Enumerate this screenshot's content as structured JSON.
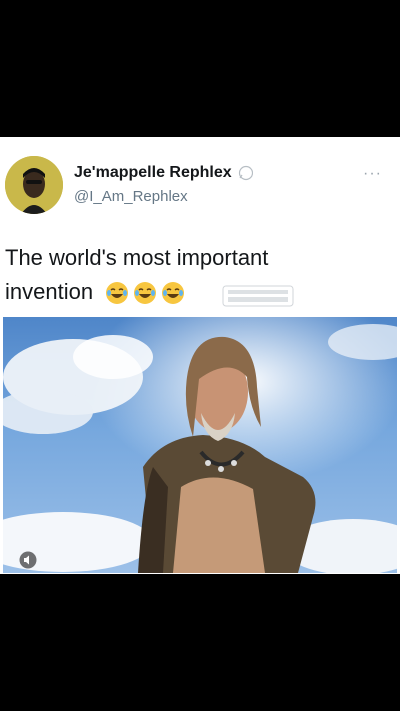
{
  "tweet": {
    "display_name": "Je'mappelle Rephlex",
    "handle": "@I_Am_Rephlex",
    "text": "The world's most important invention",
    "emojis": [
      "face-with-tears-of-joy",
      "face-with-tears-of-joy",
      "face-with-tears-of-joy"
    ],
    "more_label": "···"
  },
  "media": {
    "type": "video",
    "description_icon": "volume-icon"
  },
  "colors": {
    "name": "#14171a",
    "handle": "#657786",
    "avatar_bg": "#c9b84a",
    "sky": "#4f86c9"
  }
}
